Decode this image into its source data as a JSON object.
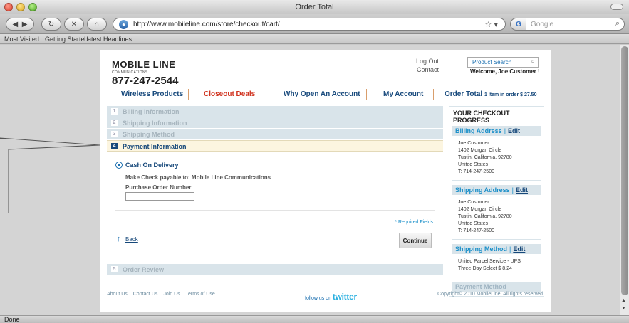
{
  "window": {
    "title": "Order Total",
    "status": "Done"
  },
  "browser": {
    "url": "http://www.mobileline.com/store/checkout/cart/",
    "search_placeholder": "Google",
    "bookmarks": [
      "Most Visited",
      "Getting Started",
      "Latest Headlines"
    ]
  },
  "header": {
    "brand": "MOBILE LINE",
    "brand_sub": "COMMUNICATIONS",
    "phone": "877-247-2544",
    "log_out": "Log Out",
    "contact": "Contact",
    "product_search_placeholder": "Product Search",
    "welcome": "Welcome, Joe Customer !"
  },
  "nav": {
    "wireless": "Wireless Products",
    "closeout": "Closeout Deals",
    "why_open": "Why Open An Account",
    "my_account": "My Account",
    "order_total": "Order Total",
    "order_total_detail": "1 Item in order $ 27.50"
  },
  "steps": [
    {
      "num": "1",
      "label": "Billing Information"
    },
    {
      "num": "2",
      "label": "Shipping Information"
    },
    {
      "num": "3",
      "label": "Shipping Method"
    },
    {
      "num": "4",
      "label": "Payment Information"
    },
    {
      "num": "5",
      "label": "Order Review"
    }
  ],
  "payment": {
    "option": "Cash On Delivery",
    "make_check": "Make Check payable to: Mobile Line Communications",
    "po_label": "Purchase Order Number",
    "po_value": "",
    "required": "* Required Fields",
    "back": "Back",
    "continue": "Continue"
  },
  "progress": {
    "title": "YOUR CHECKOUT PROGRESS",
    "edit": "Edit",
    "billing_title": "Billing Address",
    "billing_lines": [
      "Joe Customer",
      "1402 Morgan Circle",
      "Tustin, California, 92780",
      "United States",
      "T: 714-247-2500"
    ],
    "shipping_title": "Shipping Address",
    "shipping_lines": [
      "Joe Customer",
      "1402 Morgan Circle",
      "Tustin, California, 92780",
      "United States",
      "T: 714-247-2500"
    ],
    "method_title": "Shipping Method",
    "method_lines": [
      "United Parcel Service - UPS",
      "Three-Day Select $ 8.24"
    ],
    "payment_title": "Payment Method"
  },
  "footer": {
    "links": [
      "About Us",
      "Contact Us",
      "Join Us",
      "Terms of Use"
    ],
    "follow": "follow us on",
    "twitter": "twitter",
    "copyright": "Copyright© 2010 MobileLine. All rights reserved."
  }
}
